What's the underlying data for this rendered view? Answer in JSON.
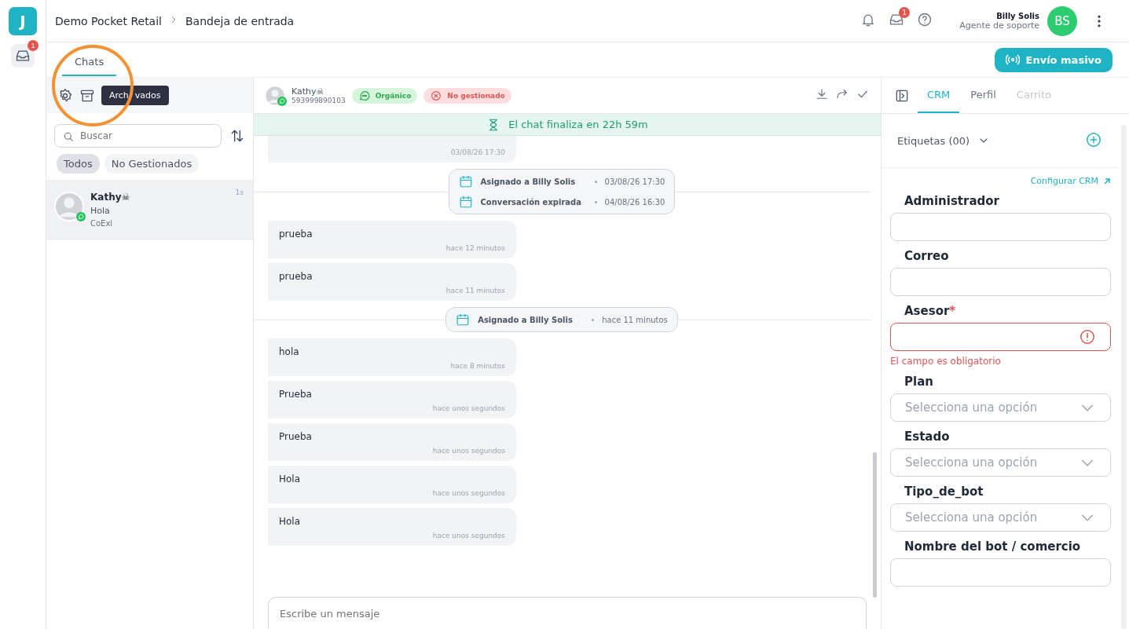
{
  "rail": {
    "logo": "J",
    "items": [
      {
        "badge": "1",
        "selected": true
      }
    ]
  },
  "header": {
    "breadcrumb": [
      "Demo Pocket Retail",
      "Bandeja de entrada"
    ],
    "inbox_badge": "1",
    "user": {
      "name": "Billy Solis",
      "role": "Agente de soporte",
      "initials": "BS"
    }
  },
  "tabs": [
    {
      "label": "Chats",
      "selected": true
    }
  ],
  "mass_button": "Envío masivo",
  "chat_list": {
    "tooltip": [
      "Arch",
      "vados"
    ],
    "search": {
      "placeholder": "Buscar"
    },
    "filters": [
      {
        "label": "Todos",
        "selected": true
      },
      {
        "label": "No Gestionados",
        "selected": false
      }
    ],
    "items": [
      {
        "name": "Kathy☠",
        "preview": "Hola",
        "source": "CoExi",
        "time": "1s",
        "selected": true
      }
    ]
  },
  "chat": {
    "contact": {
      "name": "Kathy☠",
      "phone": "593999890103"
    },
    "tags": [
      {
        "label": "Orgánico",
        "kind": "ok"
      },
      {
        "label": "No gestionado",
        "kind": "bad"
      }
    ],
    "banner": "El chat finaliza en 22h 59m",
    "items": [
      {
        "kind": "partial",
        "time": "03/08/26 17:30"
      },
      {
        "kind": "events",
        "events": [
          {
            "text": "Asignado a Billy Solis",
            "time": "03/08/26 17:30"
          },
          {
            "text": "Conversación expirada",
            "time": "04/08/26 16:30"
          }
        ]
      },
      {
        "kind": "message",
        "text": "prueba",
        "time": "hace 12 minutos"
      },
      {
        "kind": "message",
        "text": "prueba",
        "time": "hace 11 minutos"
      },
      {
        "kind": "events",
        "events": [
          {
            "text": "Asignado a Billy Solis",
            "time": "hace 11 minutos"
          }
        ]
      },
      {
        "kind": "message",
        "text": "hola",
        "time": "hace 8 minutos"
      },
      {
        "kind": "message",
        "text": "Prueba",
        "time": "hace unos segundos"
      },
      {
        "kind": "message",
        "text": "Prueba",
        "time": "hace unos segundos"
      },
      {
        "kind": "message",
        "text": "Hola",
        "time": "hace unos segundos"
      },
      {
        "kind": "message",
        "text": "Hola",
        "time": "hace unos segundos"
      }
    ],
    "composer": {
      "placeholder": "Escribe un mensaje"
    }
  },
  "panel": {
    "tabs": [
      {
        "label": "CRM",
        "selected": true,
        "disabled": false
      },
      {
        "label": "Perfil",
        "selected": false,
        "disabled": false
      },
      {
        "label": "Carrito",
        "selected": false,
        "disabled": true
      }
    ],
    "labels": "Etiquetas (00)",
    "config_link": "Configurar CRM",
    "fields": [
      {
        "label": "Administrador",
        "kind": "text"
      },
      {
        "label": "Correo",
        "kind": "text"
      },
      {
        "label": "Asesor",
        "kind": "text",
        "required_mark": "*",
        "error": "El campo es obligatorio"
      },
      {
        "label": "Plan",
        "kind": "select",
        "placeholder": "Selecciona una opción"
      },
      {
        "label": "Estado",
        "kind": "select",
        "placeholder": "Selecciona una opción"
      },
      {
        "label": "Tipo_de_bot",
        "kind": "select",
        "placeholder": "Selecciona una opción"
      },
      {
        "label": "Nombre del bot / comercio",
        "kind": "text"
      }
    ]
  }
}
